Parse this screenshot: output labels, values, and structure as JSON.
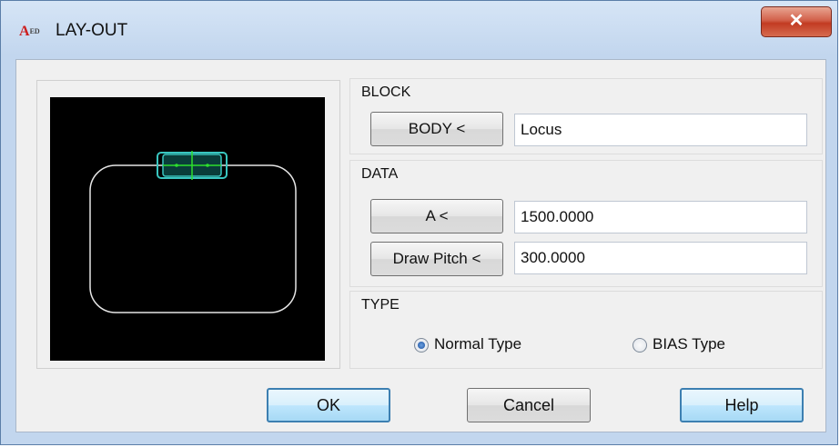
{
  "window": {
    "title": "LAY-OUT",
    "icon_text": "A",
    "icon_subtext": "ED",
    "close_glyph": "✕"
  },
  "block": {
    "label": "BLOCK",
    "body_button": "BODY <",
    "body_value": "Locus"
  },
  "data_group": {
    "label": "DATA",
    "a_button": "A <",
    "a_value": "1500.0000",
    "pitch_button": "Draw Pitch <",
    "pitch_value": "300.0000"
  },
  "type_group": {
    "label": "TYPE",
    "normal_label": "Normal Type",
    "bias_label": "BIAS Type",
    "selected": "Normal Type"
  },
  "buttons": {
    "ok": "OK",
    "cancel": "Cancel",
    "help": "Help"
  },
  "preview": {
    "background": "#000000",
    "outline_color": "#e6e6e6",
    "block_color": "#39c6c0",
    "center_line_color": "#2ddf2d"
  }
}
